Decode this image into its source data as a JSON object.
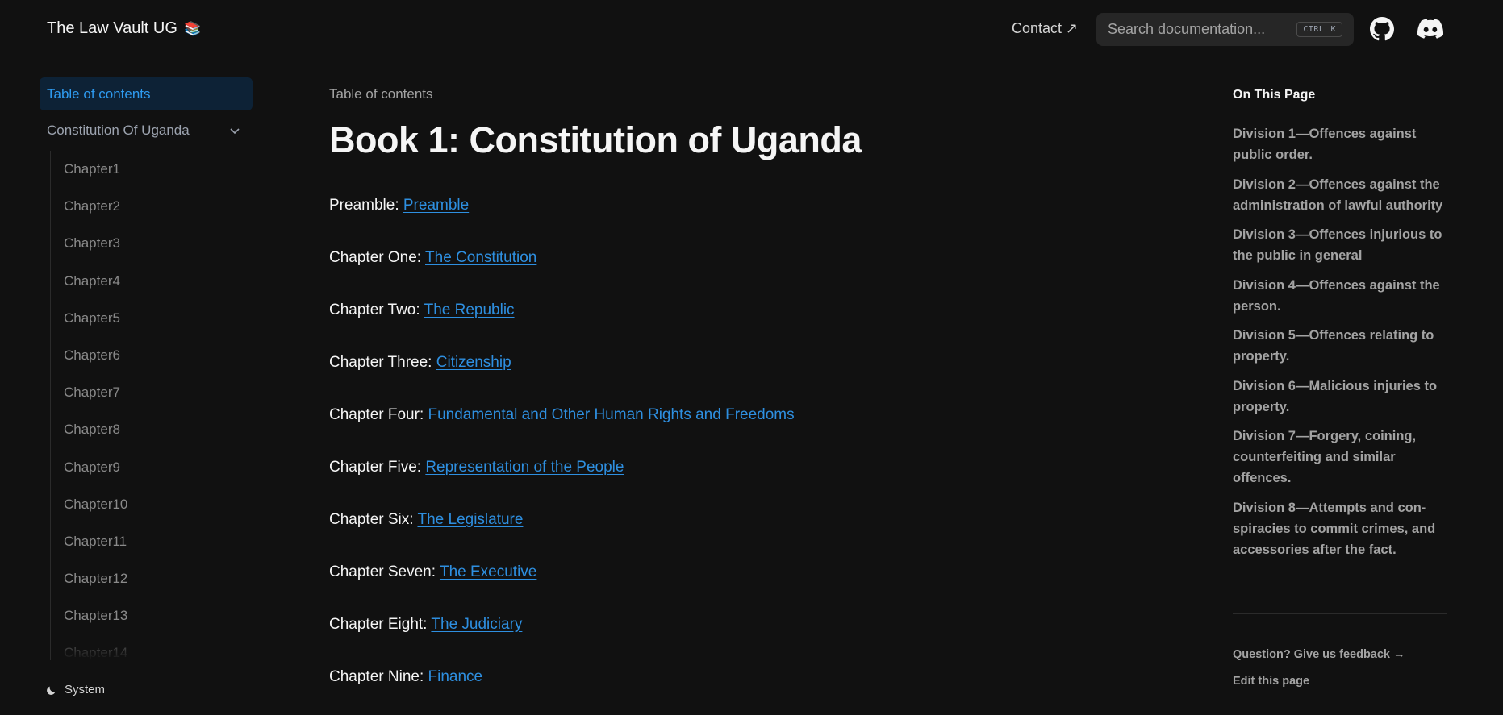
{
  "header": {
    "site_title": "The Law Vault UG",
    "site_emoji": "📚",
    "contact_label": "Contact ↗",
    "search_placeholder": "Search documentation...",
    "shortcut_ctrl": "CTRL",
    "shortcut_key": "K",
    "github_icon": "github-icon",
    "discord_icon": "discord-icon"
  },
  "sidebar": {
    "active_item": "Table of contents",
    "section": "Constitution Of Uganda",
    "chapters": [
      "Chapter1",
      "Chapter2",
      "Chapter3",
      "Chapter4",
      "Chapter5",
      "Chapter6",
      "Chapter7",
      "Chapter8",
      "Chapter9",
      "Chapter10",
      "Chapter11",
      "Chapter12",
      "Chapter13",
      "Chapter14"
    ],
    "theme_label": "System",
    "theme_icon": "moon-icon"
  },
  "main": {
    "breadcrumb": "Table of contents",
    "title": "Book 1: Constitution of Uganda",
    "rows": [
      {
        "label": "Preamble: ",
        "link": "Preamble"
      },
      {
        "label": "Chapter One: ",
        "link": "The Constitution"
      },
      {
        "label": "Chapter Two: ",
        "link": "The Republic"
      },
      {
        "label": "Chapter Three: ",
        "link": "Citizenship"
      },
      {
        "label": "Chapter Four: ",
        "link": "Fundamental and Other Human Rights and Freedoms"
      },
      {
        "label": "Chapter Five: ",
        "link": "Representation of the People"
      },
      {
        "label": "Chapter Six: ",
        "link": "The Legislature"
      },
      {
        "label": "Chapter Seven: ",
        "link": "The Executive"
      },
      {
        "label": "Chapter Eight: ",
        "link": "The Judiciary"
      },
      {
        "label": "Chapter Nine: ",
        "link": "Finance"
      }
    ]
  },
  "toc": {
    "title": "On This Page",
    "items": [
      "Division 1—Offences against public order.",
      "Division 2—Offences against the administration of lawful authority",
      "Division 3—Offences injurious to the public in general",
      "Division 4—Offences against the person.",
      "Division 5—Offences relating to property.",
      "Division 6—Malicious injuries to property.",
      "Division 7—Forgery, coining, counterfeiting and similar offences.",
      "Division 8—Attempts and con-spiracies to commit crimes, and accessories after the fact."
    ],
    "feedback": "Question? Give us feedback →",
    "edit": "Edit this page"
  },
  "colors": {
    "background": "#111111",
    "link": "#2e8fe0",
    "active_bg": "#0d2236",
    "active_text": "#2e9bf0"
  }
}
